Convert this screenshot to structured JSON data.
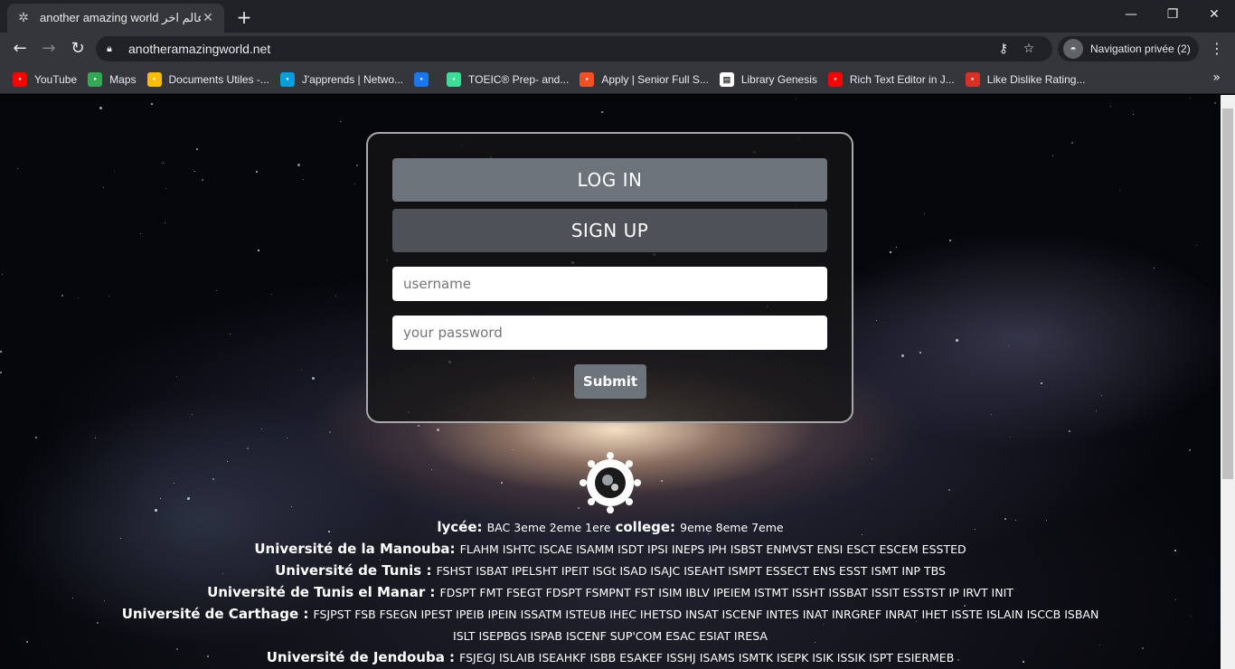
{
  "browser": {
    "tab_title": "another amazing world عالم اخر",
    "url": "anotheramazingworld.net",
    "profile_label": "Navigation privée (2)",
    "bookmarks": [
      {
        "label": "YouTube",
        "icon": "youtube-icon",
        "color": "#ff0000"
      },
      {
        "label": "Maps",
        "icon": "maps-icon",
        "color": "#34a853"
      },
      {
        "label": "Documents Utiles -...",
        "icon": "drive-icon",
        "color": "#fbbc04"
      },
      {
        "label": "J'apprends | Netwo...",
        "icon": "cisco-icon",
        "color": "#049fd9"
      },
      {
        "label": "",
        "icon": "facebook-icon",
        "color": "#1877f2"
      },
      {
        "label": "TOEIC® Prep- and...",
        "icon": "check-icon",
        "color": "#3ddc97"
      },
      {
        "label": "Apply | Senior Full S...",
        "icon": "microsoft-icon",
        "color": "#f25022"
      },
      {
        "label": "Library Genesis",
        "icon": "book-icon",
        "color": "#ffffff"
      },
      {
        "label": "Rich Text Editor in J...",
        "icon": "youtube-icon",
        "color": "#ff0000"
      },
      {
        "label": "Like Dislike Rating...",
        "icon": "cw-icon",
        "color": "#d93025"
      }
    ]
  },
  "form": {
    "login_label": "LOG IN",
    "signup_label": "SIGN UP",
    "username_placeholder": "username",
    "password_placeholder": "your password",
    "submit_label": "Submit"
  },
  "directory": [
    {
      "parts": [
        {
          "head": "lycée:",
          "list": "BAC 3eme 2eme 1ere"
        },
        {
          "head": "college:",
          "list": "9eme 8eme 7eme"
        }
      ]
    },
    {
      "parts": [
        {
          "head": "Université de la Manouba:",
          "list": "FLAHM ISHTC ISCAE ISAMM ISDT IPSI INEPS IPH ISBST ENMVST ENSI ESCT ESCEM ESSTED"
        }
      ]
    },
    {
      "parts": [
        {
          "head": "Université de Tunis :",
          "list": "FSHST ISBAT IPELSHT IPEIT ISGt ISAD ISAJC ISEAHT ISMPT ESSECT ENS ESST ISMT INP TBS"
        }
      ]
    },
    {
      "parts": [
        {
          "head": "Université de Tunis el Manar :",
          "list": "FDSPT FMT FSEGT FDSPT FSMPNT FST ISIM IBLV IPEIEM ISTMT ISSHT ISSBAT ISSIT ESSTST IP IRVT INIT"
        }
      ]
    },
    {
      "parts": [
        {
          "head": "Université de Carthage :",
          "list": "FSJPST FSB FSEGN IPEST IPEIB IPEIN ISSATM ISTEUB IHEC IHETSD INSAT ISCENF INTES INAT INRGREF INRAT IHET ISSTE ISLAIN ISCCB ISBAN"
        }
      ]
    },
    {
      "parts": [
        {
          "head": "",
          "list": "ISLT ISEPBGS ISPAB ISCENF SUP'COM ESAC ESIAT IRESA"
        }
      ]
    },
    {
      "parts": [
        {
          "head": "Université de Jendouba :",
          "list": "FSJEGJ ISLAIB ISEAHKF ISBB ESAKEF ISSHJ ISAMS ISMTK ISEPK ISIK ISSIK ISPT ESIERMEB"
        }
      ]
    }
  ]
}
